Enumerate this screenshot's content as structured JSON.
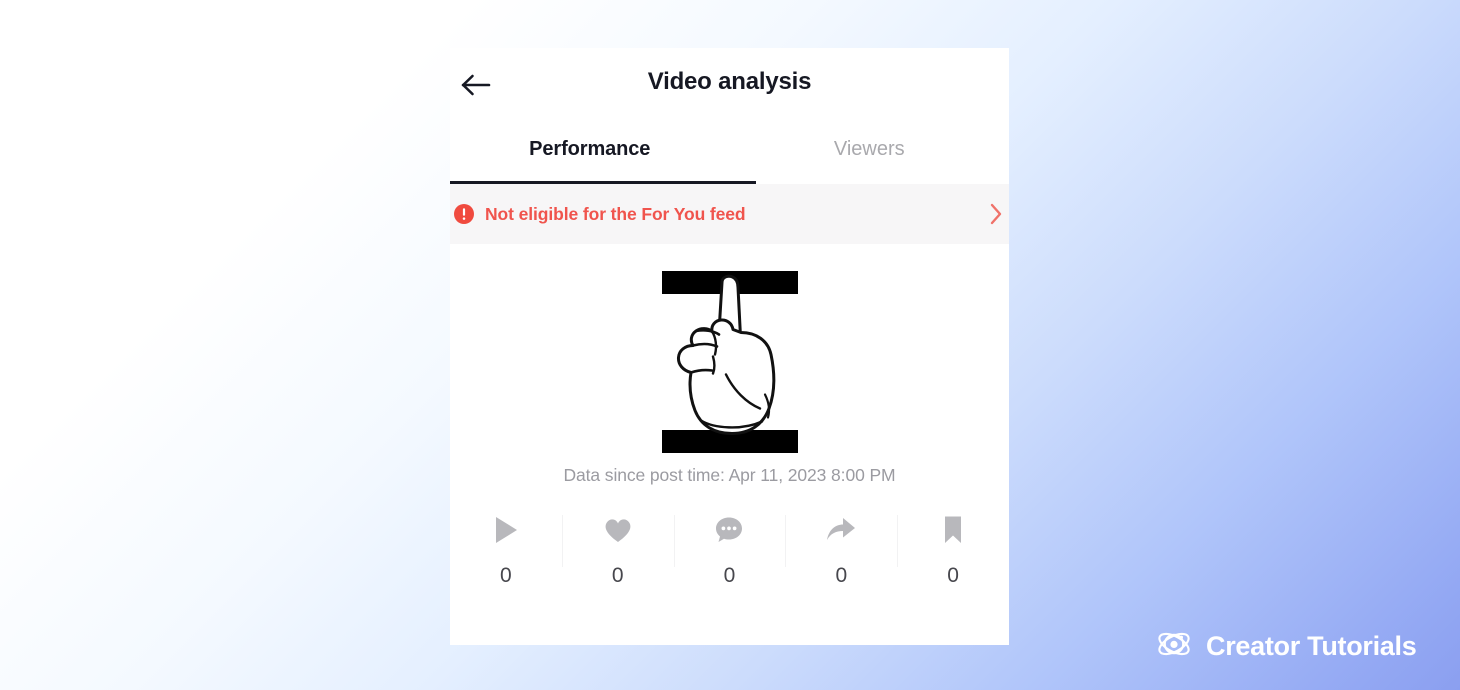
{
  "background": {
    "gradient_from": "#ffffff",
    "gradient_to": "#8b9ff0"
  },
  "header": {
    "back_label": "Back",
    "title": "Video analysis"
  },
  "tabs": [
    {
      "label": "Performance",
      "active": true
    },
    {
      "label": "Viewers",
      "active": false
    }
  ],
  "banner": {
    "text": "Not eligible for the For You feed",
    "icon": "alert-circle-icon",
    "chevron": "chevron-right-icon",
    "accent_color": "#f0544d",
    "background_color": "#f7f6f7"
  },
  "video": {
    "thumbnail_alt": "Pointing up hand illustration with black letterbox bars",
    "data_since": "Data since post time: Apr 11, 2023 8:00 PM"
  },
  "stats": [
    {
      "icon": "play-icon",
      "name": "views",
      "value": "0"
    },
    {
      "icon": "heart-icon",
      "name": "likes",
      "value": "0"
    },
    {
      "icon": "comment-icon",
      "name": "comments",
      "value": "0"
    },
    {
      "icon": "share-icon",
      "name": "shares",
      "value": "0"
    },
    {
      "icon": "bookmark-icon",
      "name": "favorites",
      "value": "0"
    }
  ],
  "watermark": {
    "text": "Creator Tutorials",
    "icon": "atom-logo-icon",
    "color": "#ffffff"
  }
}
